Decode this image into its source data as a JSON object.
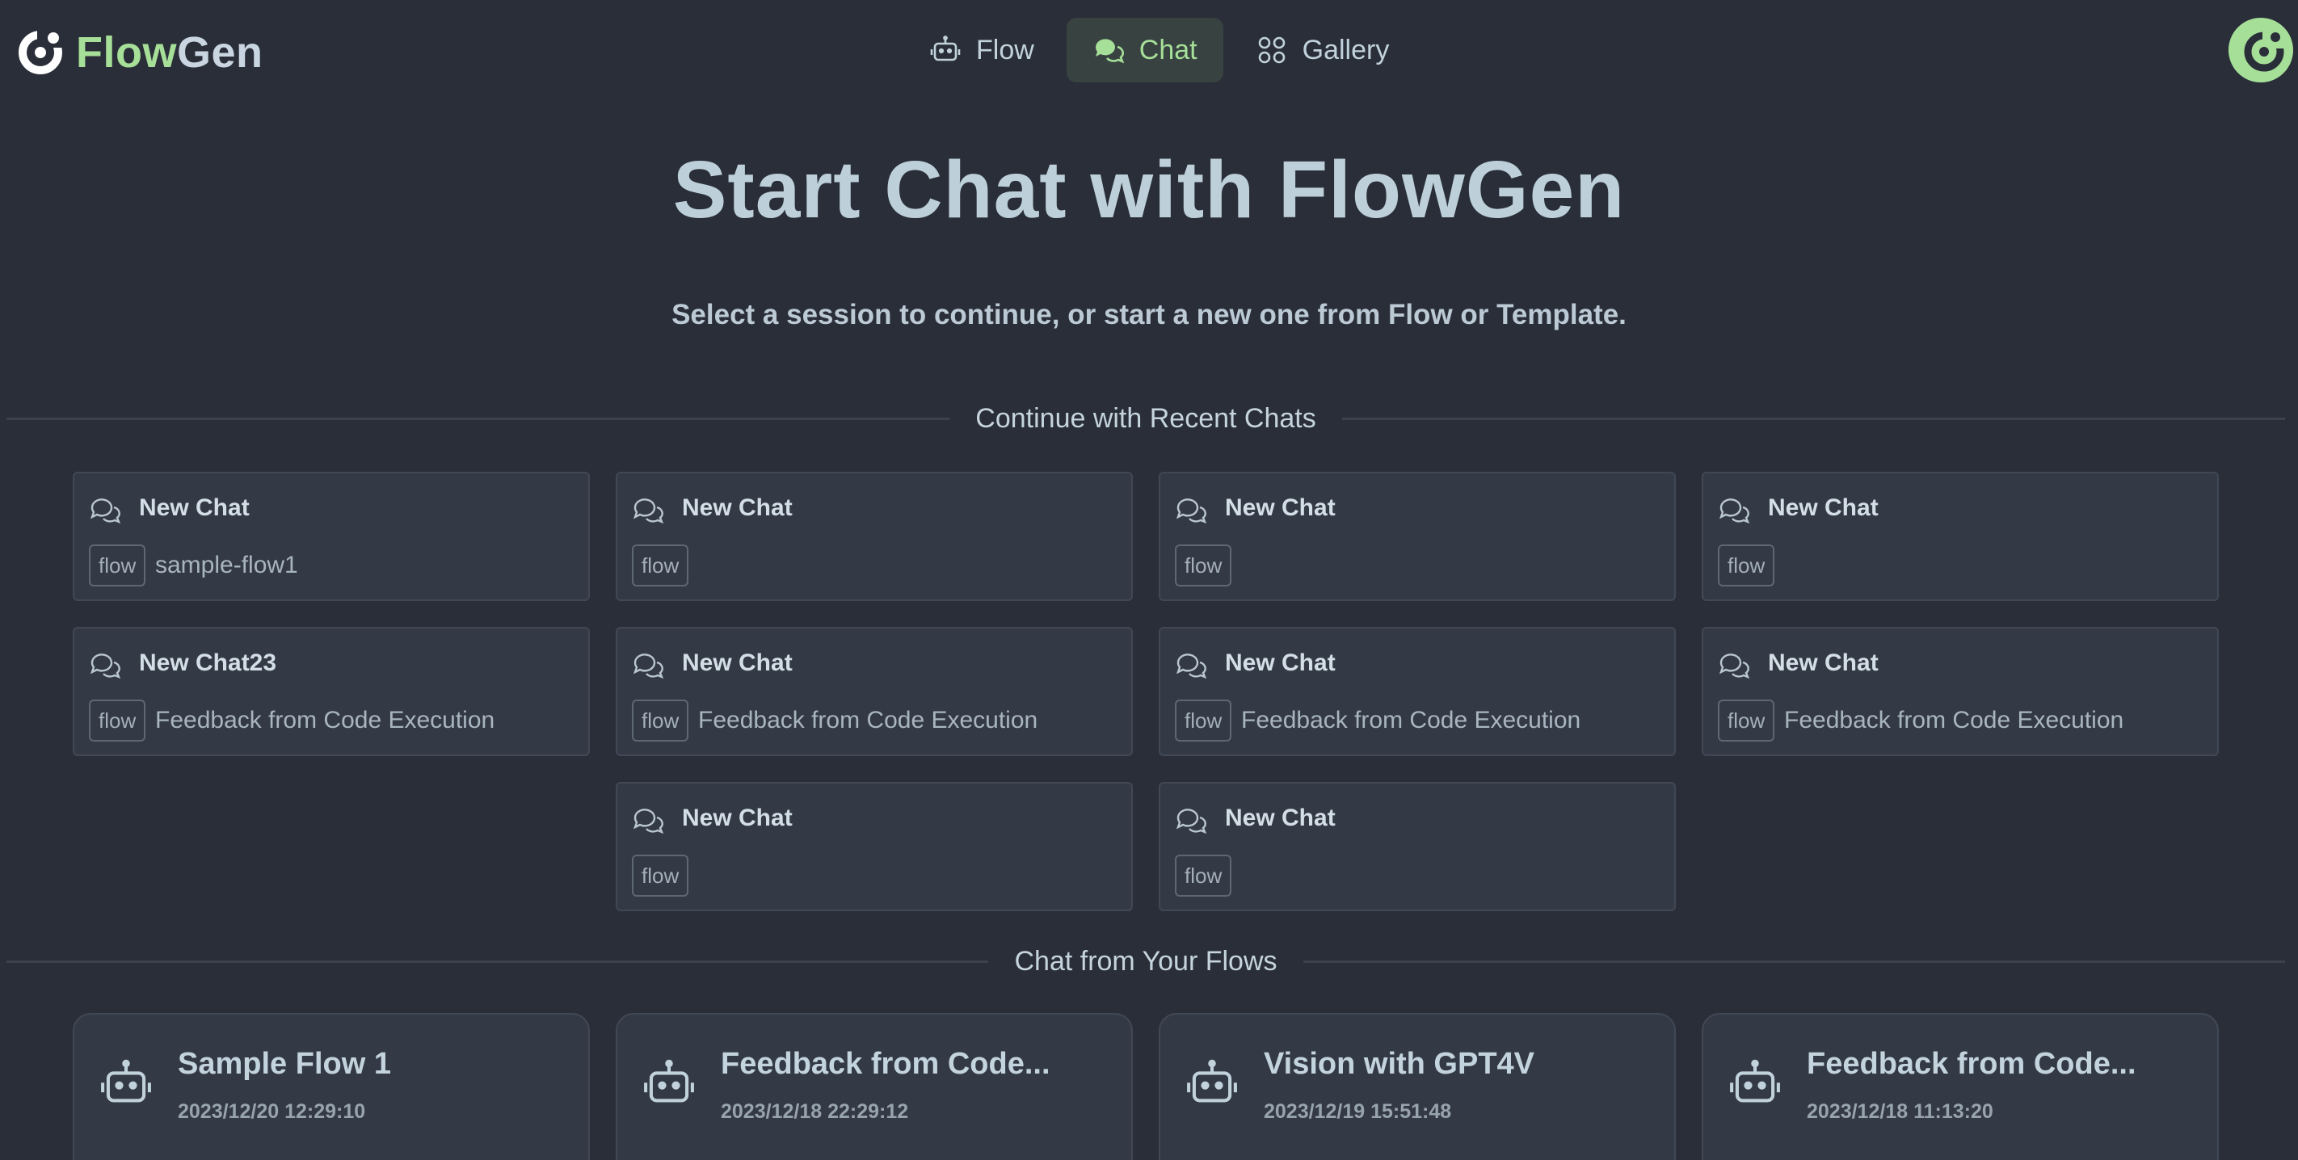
{
  "app": {
    "brand_flow": "Flow",
    "brand_gen": "Gen",
    "accent_color": "#a6df98"
  },
  "nav": [
    {
      "label": "Flow",
      "icon": "robot-icon",
      "active": false
    },
    {
      "label": "Chat",
      "icon": "chat-bubbles-icon",
      "active": true
    },
    {
      "label": "Gallery",
      "icon": "grid-icon",
      "active": false
    }
  ],
  "hero": {
    "title": "Start Chat with FlowGen",
    "subtitle": "Select a session to continue, or start a new one from Flow or Template."
  },
  "recent": {
    "heading": "Continue with Recent Chats",
    "items": [
      {
        "title": "New Chat",
        "tag": "flow",
        "subtitle": "sample-flow1"
      },
      {
        "title": "New Chat",
        "tag": "flow",
        "subtitle": ""
      },
      {
        "title": "New Chat",
        "tag": "flow",
        "subtitle": ""
      },
      {
        "title": "New Chat",
        "tag": "flow",
        "subtitle": ""
      },
      {
        "title": "New Chat23",
        "tag": "flow",
        "subtitle": "Feedback from Code Execution"
      },
      {
        "title": "New Chat",
        "tag": "flow",
        "subtitle": "Feedback from Code Execution"
      },
      {
        "title": "New Chat",
        "tag": "flow",
        "subtitle": "Feedback from Code Execution"
      },
      {
        "title": "New Chat",
        "tag": "flow",
        "subtitle": "Feedback from Code Execution"
      },
      {
        "title": "New Chat",
        "tag": "flow",
        "subtitle": ""
      },
      {
        "title": "New Chat",
        "tag": "flow",
        "subtitle": ""
      }
    ]
  },
  "flows": {
    "heading": "Chat from Your Flows",
    "items": [
      {
        "title": "Sample Flow 1",
        "date": "2023/12/20 12:29:10"
      },
      {
        "title": "Feedback from Code...",
        "date": "2023/12/18 22:29:12"
      },
      {
        "title": "Vision with GPT4V",
        "date": "2023/12/19 15:51:48"
      },
      {
        "title": "Feedback from Code...",
        "date": "2023/12/18 11:13:20"
      }
    ]
  }
}
